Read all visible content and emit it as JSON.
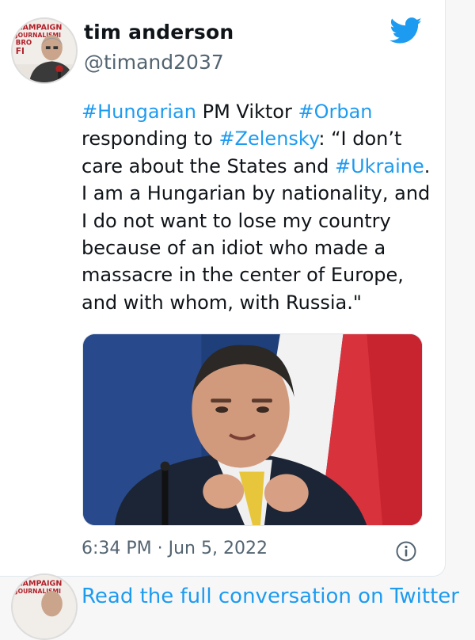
{
  "tweet": {
    "author_name": "tim anderson",
    "author_handle": "@timand2037",
    "avatar_badge_lines": [
      "CAMPAIGN",
      "JOURNALISMI",
      "BRO",
      "FI"
    ],
    "text_segments": [
      {
        "text": "#Hungarian",
        "type": "hashtag"
      },
      {
        "text": " PM Viktor ",
        "type": "text"
      },
      {
        "text": "#Orban",
        "type": "hashtag"
      },
      {
        "text": " responding to ",
        "type": "text"
      },
      {
        "text": "#Zelensky",
        "type": "hashtag"
      },
      {
        "text": ": “I don’t care about the States and ",
        "type": "text"
      },
      {
        "text": "#Ukraine",
        "type": "hashtag"
      },
      {
        "text": ". I am a Hungarian by nationality, and I do not want to lose my country because of an idiot who made a massacre in the center of Europe, and with whom, with Russia.\"",
        "type": "text"
      }
    ],
    "timestamp": "6:34 PM · Jun 5, 2022",
    "icons": {
      "brand": "twitter-bird-icon",
      "info": "info-icon"
    }
  },
  "footer": {
    "read_more": "Read the full conversation on Twitter"
  },
  "colors": {
    "accent": "#1d9bf0",
    "text_primary": "#0f1419",
    "text_secondary": "#536471"
  }
}
